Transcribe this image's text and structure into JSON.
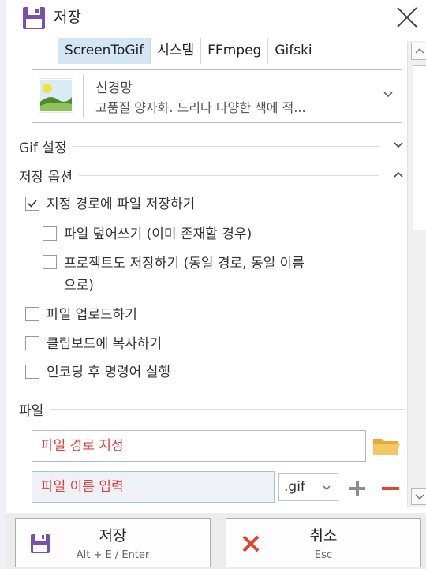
{
  "window": {
    "title": "저장"
  },
  "tabs": [
    {
      "label": "ScreenToGif",
      "active": true
    },
    {
      "label": "시스템",
      "active": false
    },
    {
      "label": "FFmpeg",
      "active": false
    },
    {
      "label": "Gifski",
      "active": false
    }
  ],
  "preset": {
    "name": "신경망",
    "description": "고품질 양자화. 느리나 다양한 색에 적..."
  },
  "sections": {
    "gif_settings": "Gif 설정",
    "save_options": "저장 옵션",
    "file": "파일"
  },
  "options": [
    {
      "label": "지정 경로에 파일 저장하기",
      "checked": true
    },
    {
      "label": "파일 덮어쓰기 (이미 존재할 경우)",
      "checked": false
    },
    {
      "label": "프로젝트도 저장하기 (동일 경로, 동일 이름",
      "label2": "으로)",
      "checked": false
    },
    {
      "label": "파일 업로드하기",
      "checked": false
    },
    {
      "label": "클립보드에 복사하기",
      "checked": false
    },
    {
      "label": "인코딩 후 명령어 실행",
      "checked": false
    }
  ],
  "file": {
    "path_placeholder": "파일 경로 지정",
    "name_placeholder": "파일 이름  입력",
    "extension": ".gif"
  },
  "footer": {
    "save": {
      "label": "저장",
      "shortcut": "Alt + E / Enter"
    },
    "cancel": {
      "label": "취소",
      "shortcut": "Esc"
    }
  },
  "colors": {
    "accent": "#7a4fb0",
    "placeholder": "#e43a3a",
    "cancel": "#e2452d",
    "folder": "#f2c25a"
  }
}
